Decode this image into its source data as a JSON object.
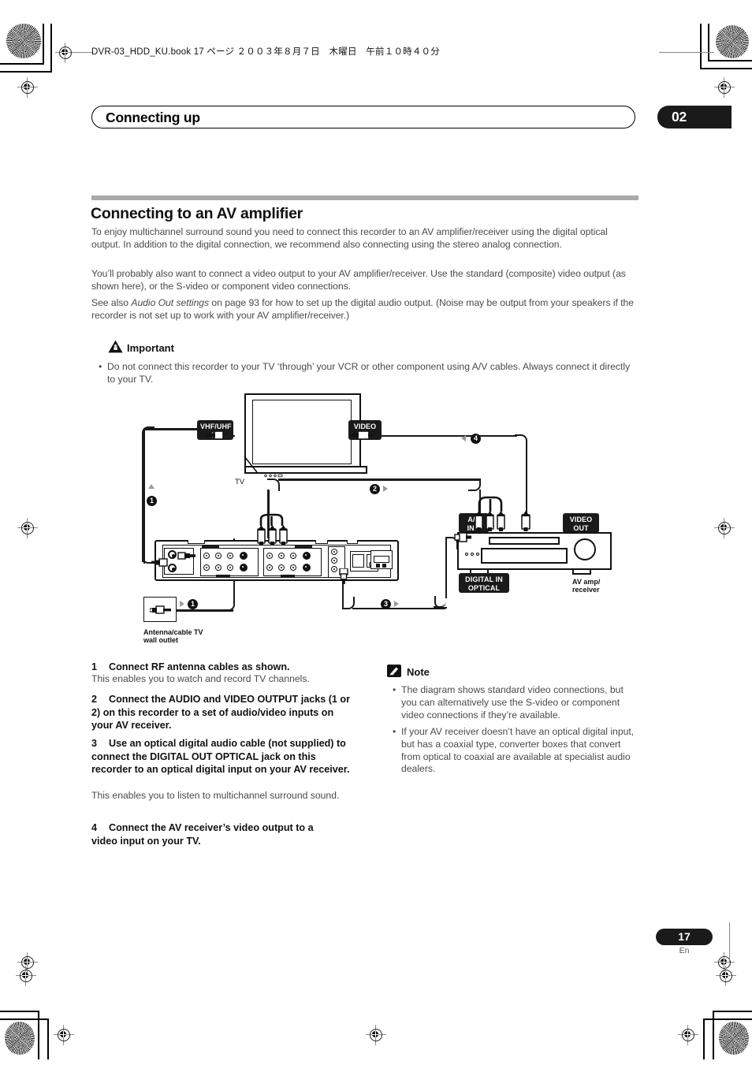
{
  "file_header": {
    "text": "DVR-03_HDD_KU.book  17 ページ  ２００３年８月７日　木曜日　午前１０時４０分"
  },
  "running_head": {
    "title": "Connecting up",
    "chapter": "02"
  },
  "section": {
    "heading": "Connecting to an AV amplifier",
    "paragraphs": [
      "To enjoy multichannel surround sound you need to connect this recorder to an AV amplifier/receiver using the digital optical output. In addition to the digital connection, we recommend also connecting using the stereo analog connection.",
      "You’ll probably also want to connect a video output to your AV amplifier/receiver. Use the standard (composite) video output (as shown here), or the S-video or component video connections."
    ],
    "paragraph3_pre": "See also ",
    "paragraph3_italic": "Audio Out settings",
    "paragraph3_post": " on page 93 for how to set up the digital audio output. (Noise may be output from your speakers if the recorder is not set up to work with your AV amplifier/receiver.)"
  },
  "important": {
    "title": "Important",
    "icon": "warning-triangle-icon",
    "bullet": "Do not connect this recorder to your TV ‘through’ your VCR or other component using A/V cables. Always connect it directly to your TV.",
    "bullet_mark": "•"
  },
  "diagram": {
    "labels": {
      "vhf_uhf_in": "VHF/UHF\nIN",
      "video_in": "VIDEO\nIN",
      "av_in_1": "A/V\nIN 1",
      "video_out": "VIDEO\nOUT",
      "digital_in_optical": "DIGITAL IN\nOPTICAL",
      "tv": "TV",
      "av_amp_receiver": "AV amp/\nreceiver",
      "wall_outlet": "Antenna/cable TV\nwall outlet"
    },
    "callouts": [
      "1",
      "2",
      "3",
      "4"
    ]
  },
  "steps": [
    {
      "num": "1",
      "heading": "Connect RF antenna cables as shown.",
      "body": "This enables you to watch and record TV channels."
    },
    {
      "num": "2",
      "heading": "Connect the AUDIO and VIDEO OUTPUT jacks (1 or 2) on this recorder to a set of audio/video inputs on your AV receiver.",
      "body": ""
    },
    {
      "num": "3",
      "heading": "Use an optical digital audio cable (not supplied) to connect the DIGITAL OUT OPTICAL jack on this recorder to an optical digital input on your AV receiver.",
      "body": "This enables you to listen to multichannel surround sound."
    },
    {
      "num": "4",
      "heading": "Connect the AV receiver’s video output to a video input on your TV.",
      "body": ""
    }
  ],
  "note": {
    "title": "Note",
    "icon": "pencil-note-icon",
    "bullet_mark": "•",
    "bullets": [
      "The diagram shows standard video connections, but you can alternatively use the S-video or component video connections if they’re available.",
      "If your AV receiver doesn’t have an optical digital input, but has a coaxial type, converter boxes that convert from optical to coaxial are available at specialist audio dealers."
    ]
  },
  "footer": {
    "page": "17",
    "lang": "En"
  },
  "colors": {
    "ink": "#111111",
    "body_text": "#4a4a4a",
    "rule": "#a9a9a9",
    "plate_bg": "#1a1a1a",
    "arrow_gray": "#9a9a9a"
  }
}
